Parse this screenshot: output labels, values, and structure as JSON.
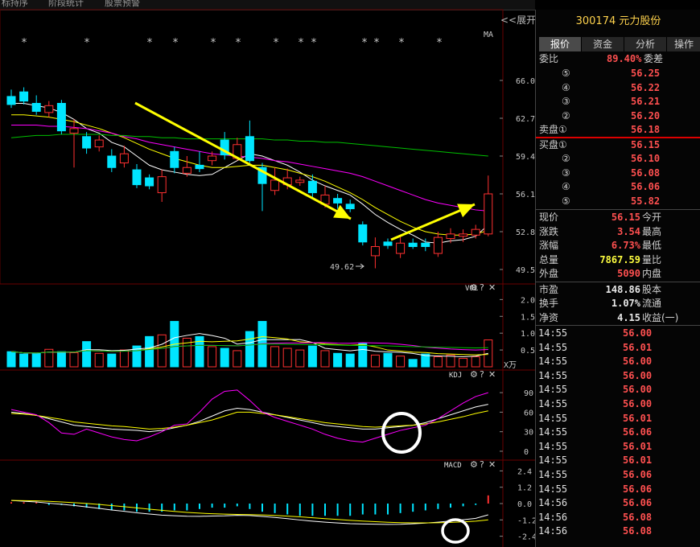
{
  "top_tabs": [
    "标持序",
    "阶段统计",
    "股票预警"
  ],
  "expand_label": "<<展开",
  "stock_title": "300174 元力股份",
  "side_tabs": [
    "报价",
    "资金",
    "分析",
    "操作"
  ],
  "order_book": {
    "wei_bi_label": "委比",
    "wei_bi_value": "89.40%",
    "wei_cha_label": "委差",
    "asks": [
      {
        "label": "⑤",
        "price": "56.25"
      },
      {
        "label": "④",
        "price": "56.22"
      },
      {
        "label": "③",
        "price": "56.21"
      },
      {
        "label": "②",
        "price": "56.20"
      },
      {
        "label": "卖盘①",
        "price": "56.18"
      }
    ],
    "bids": [
      {
        "label": "买盘①",
        "price": "56.15"
      },
      {
        "label": "②",
        "price": "56.10"
      },
      {
        "label": "③",
        "price": "56.08"
      },
      {
        "label": "④",
        "price": "56.06"
      },
      {
        "label": "⑤",
        "price": "55.82"
      }
    ]
  },
  "quote": [
    {
      "label": "现价",
      "value": "56.15",
      "label2": "今开"
    },
    {
      "label": "涨跌",
      "value": "3.54",
      "label2": "最高"
    },
    {
      "label": "涨幅",
      "value": "6.73%",
      "label2": "最低"
    },
    {
      "label": "总量",
      "value": "7867.59",
      "label2": "量比"
    },
    {
      "label": "外盘",
      "value": "5090",
      "label2": "内盘"
    }
  ],
  "fundamentals": [
    {
      "label": "市盈",
      "value": "148.86",
      "label2": "股本"
    },
    {
      "label": "换手",
      "value": "1.07%",
      "label2": "流通"
    },
    {
      "label": "净资",
      "value": "4.15",
      "label2": "收益(一)"
    }
  ],
  "trades": [
    {
      "time": "14:55",
      "price": "56.00"
    },
    {
      "time": "14:55",
      "price": "56.01"
    },
    {
      "time": "14:55",
      "price": "56.00"
    },
    {
      "time": "14:55",
      "price": "56.00"
    },
    {
      "time": "14:55",
      "price": "56.00"
    },
    {
      "time": "14:55",
      "price": "56.00"
    },
    {
      "time": "14:55",
      "price": "56.01"
    },
    {
      "time": "14:55",
      "price": "56.06"
    },
    {
      "time": "14:55",
      "price": "56.01"
    },
    {
      "time": "14:55",
      "price": "56.01"
    },
    {
      "time": "14:55",
      "price": "56.06"
    },
    {
      "time": "14:55",
      "price": "56.06"
    },
    {
      "time": "14:56",
      "price": "56.06"
    },
    {
      "time": "14:56",
      "price": "56.08"
    },
    {
      "time": "14:56",
      "price": "56.08"
    }
  ],
  "chart_labels": {
    "ma": "MA",
    "vol": "VOL",
    "kdj": "KDJ",
    "macd": "MACD",
    "vol_unit": "X万",
    "low_marker": "49.62",
    "price_ticks": [
      "66.0",
      "62.7",
      "59.4",
      "56.1",
      "52.8",
      "49.5"
    ],
    "vol_ticks": [
      "2.0",
      "1.5",
      "1.0",
      "0.5"
    ],
    "kdj_ticks": [
      "90",
      "60",
      "30",
      "0"
    ],
    "macd_ticks": [
      "2.4",
      "1.2",
      "0.0",
      "-1.2",
      "-2.4"
    ]
  },
  "colors": {
    "up": "#ff3030",
    "down": "#00e5ff",
    "ma5": "#ffffff",
    "ma10": "#ffff00",
    "ma20": "#ff00ff",
    "ma60": "#00c000",
    "arrow": "#ffff00",
    "bg": "#000000"
  },
  "chart_data": [
    {
      "type": "candlestick",
      "title": "",
      "ylim": [
        49.5,
        66.0
      ],
      "candles": [
        {
          "o": 64.6,
          "c": 63.9,
          "h": 65.2,
          "l": 63.6
        },
        {
          "o": 65.0,
          "c": 64.2,
          "h": 65.4,
          "l": 63.9
        },
        {
          "o": 64.0,
          "c": 63.3,
          "h": 64.7,
          "l": 63.0
        },
        {
          "o": 63.2,
          "c": 63.8,
          "h": 64.2,
          "l": 62.8
        },
        {
          "o": 64.0,
          "c": 61.6,
          "h": 64.3,
          "l": 61.3
        },
        {
          "o": 61.4,
          "c": 61.8,
          "h": 62.6,
          "l": 58.4
        },
        {
          "o": 61.1,
          "c": 60.1,
          "h": 61.5,
          "l": 59.6
        },
        {
          "o": 60.2,
          "c": 60.8,
          "h": 61.2,
          "l": 59.8
        },
        {
          "o": 59.4,
          "c": 58.4,
          "h": 60.0,
          "l": 58.0
        },
        {
          "o": 58.8,
          "c": 59.6,
          "h": 60.3,
          "l": 58.4
        },
        {
          "o": 58.2,
          "c": 56.9,
          "h": 58.7,
          "l": 56.6
        },
        {
          "o": 57.5,
          "c": 56.8,
          "h": 57.8,
          "l": 56.5
        },
        {
          "o": 56.2,
          "c": 57.6,
          "h": 58.2,
          "l": 55.4
        },
        {
          "o": 59.8,
          "c": 58.4,
          "h": 60.2,
          "l": 57.9
        },
        {
          "o": 57.9,
          "c": 58.4,
          "h": 59.4,
          "l": 57.6
        },
        {
          "o": 58.6,
          "c": 58.3,
          "h": 59.8,
          "l": 58.0
        },
        {
          "o": 59.0,
          "c": 59.4,
          "h": 59.8,
          "l": 58.6
        },
        {
          "o": 60.8,
          "c": 59.5,
          "h": 61.5,
          "l": 59.1
        },
        {
          "o": 59.2,
          "c": 60.4,
          "h": 61.0,
          "l": 59.0
        },
        {
          "o": 61.1,
          "c": 59.0,
          "h": 62.5,
          "l": 58.8
        },
        {
          "o": 58.4,
          "c": 57.0,
          "h": 58.8,
          "l": 54.6
        },
        {
          "o": 56.4,
          "c": 57.3,
          "h": 58.4,
          "l": 56.0
        },
        {
          "o": 56.9,
          "c": 57.5,
          "h": 58.3,
          "l": 56.5
        },
        {
          "o": 57.1,
          "c": 57.3,
          "h": 57.6,
          "l": 56.8
        },
        {
          "o": 57.2,
          "c": 56.2,
          "h": 57.8,
          "l": 55.8
        },
        {
          "o": 55.2,
          "c": 56.0,
          "h": 56.8,
          "l": 54.9
        },
        {
          "o": 55.7,
          "c": 55.3,
          "h": 56.1,
          "l": 54.8
        },
        {
          "o": 55.2,
          "c": 54.8,
          "h": 55.6,
          "l": 54.5
        },
        {
          "o": 53.4,
          "c": 51.9,
          "h": 53.7,
          "l": 51.6
        },
        {
          "o": 50.7,
          "c": 51.5,
          "h": 52.3,
          "l": 49.6
        },
        {
          "o": 51.9,
          "c": 51.6,
          "h": 52.2,
          "l": 51.3
        },
        {
          "o": 50.9,
          "c": 51.8,
          "h": 52.4,
          "l": 50.5
        },
        {
          "o": 51.8,
          "c": 51.5,
          "h": 52.2,
          "l": 51.3
        },
        {
          "o": 51.8,
          "c": 51.5,
          "h": 52.2,
          "l": 51.1
        },
        {
          "o": 50.9,
          "c": 52.3,
          "h": 52.8,
          "l": 50.6
        },
        {
          "o": 52.2,
          "c": 52.6,
          "h": 53.1,
          "l": 51.8
        },
        {
          "o": 52.4,
          "c": 52.6,
          "h": 53.0,
          "l": 51.9
        },
        {
          "o": 52.5,
          "c": 53.0,
          "h": 53.4,
          "l": 52.2
        },
        {
          "o": 52.6,
          "c": 56.1,
          "h": 57.7,
          "l": 52.4
        }
      ],
      "ma": {
        "ma5": [
          64.0,
          64.0,
          63.8,
          63.6,
          63.2,
          62.6,
          61.8,
          61.4,
          60.6,
          60.2,
          59.4,
          58.6,
          58.2,
          58.0,
          57.8,
          57.7,
          57.8,
          58.4,
          59.0,
          59.6,
          59.4,
          59.0,
          58.6,
          58.0,
          57.3,
          56.8,
          56.4,
          56.0,
          55.2,
          54.3,
          53.6,
          53.0,
          52.5,
          51.9,
          51.8,
          52.0,
          52.1,
          52.4,
          53.4
        ],
        "ma10": [
          63.0,
          63.0,
          62.9,
          62.8,
          62.6,
          62.4,
          62.1,
          61.8,
          61.4,
          61.0,
          60.5,
          60.0,
          59.6,
          59.2,
          58.9,
          58.6,
          58.4,
          58.4,
          58.5,
          58.6,
          58.6,
          58.4,
          58.2,
          57.9,
          57.6,
          57.2,
          56.7,
          56.2,
          55.6,
          54.9,
          54.3,
          53.7,
          53.2,
          52.8,
          52.6,
          52.5,
          52.5,
          52.6,
          52.9
        ],
        "ma20": [
          62.1,
          62.1,
          62.1,
          62.0,
          62.0,
          61.9,
          61.8,
          61.6,
          61.4,
          61.1,
          60.9,
          60.6,
          60.4,
          60.2,
          60.0,
          59.8,
          59.6,
          59.5,
          59.4,
          59.3,
          59.2,
          59.0,
          58.9,
          58.7,
          58.5,
          58.3,
          58.1,
          57.9,
          57.6,
          57.2,
          56.8,
          56.4,
          56.0,
          55.6,
          55.3,
          55.1,
          54.9,
          54.7,
          54.6
        ],
        "ma60": [
          61.0,
          61.1,
          61.2,
          61.2,
          61.3,
          61.3,
          61.3,
          61.3,
          61.2,
          61.2,
          61.1,
          61.1,
          61.0,
          61.0,
          60.9,
          60.9,
          60.9,
          60.9,
          60.9,
          60.9,
          60.9,
          60.8,
          60.8,
          60.7,
          60.7,
          60.6,
          60.6,
          60.5,
          60.4,
          60.3,
          60.2,
          60.1,
          60.0,
          59.9,
          59.8,
          59.7,
          59.6,
          59.5,
          59.4
        ]
      }
    },
    {
      "type": "bar",
      "title": "VOL",
      "ylim": [
        0,
        2.2
      ],
      "values": [
        0.45,
        0.38,
        0.4,
        0.52,
        0.45,
        0.42,
        0.75,
        0.4,
        0.38,
        0.5,
        0.62,
        0.9,
        0.95,
        1.35,
        0.85,
        0.9,
        0.6,
        0.55,
        0.48,
        1.05,
        1.35,
        0.6,
        0.55,
        0.5,
        0.62,
        0.48,
        0.4,
        0.38,
        0.7,
        0.35,
        0.4,
        0.32,
        0.22,
        0.38,
        0.3,
        0.35,
        0.25,
        0.3,
        0.8
      ]
    },
    {
      "type": "line",
      "title": "KDJ",
      "ylim": [
        -5,
        100
      ],
      "series": [
        {
          "values": [
            60,
            58,
            55,
            50,
            45,
            40,
            38,
            36,
            34,
            33,
            32,
            30,
            32,
            36,
            40,
            46,
            54,
            62,
            66,
            64,
            60,
            56,
            52,
            48,
            44,
            40,
            38,
            36,
            34,
            34,
            36,
            38,
            40,
            44,
            50,
            56,
            62,
            68,
            72
          ]
        },
        {
          "values": [
            58,
            57,
            55,
            52,
            49,
            45,
            43,
            41,
            39,
            38,
            36,
            34,
            35,
            37,
            40,
            44,
            48,
            54,
            60,
            60,
            58,
            56,
            53,
            50,
            47,
            44,
            42,
            40,
            38,
            37,
            38,
            39,
            40,
            42,
            45,
            49,
            53,
            58,
            62
          ]
        },
        {
          "values": [
            64,
            60,
            56,
            44,
            28,
            26,
            34,
            28,
            22,
            18,
            16,
            22,
            30,
            40,
            42,
            60,
            80,
            92,
            94,
            78,
            60,
            52,
            46,
            40,
            34,
            26,
            20,
            16,
            14,
            20,
            26,
            32,
            36,
            40,
            50,
            62,
            74,
            84,
            90
          ]
        }
      ]
    },
    {
      "type": "bar",
      "title": "MACD",
      "ylim": [
        -2.6,
        2.6
      ],
      "values": [
        0.1,
        0.1,
        0.1,
        -0.1,
        -0.1,
        -0.2,
        -0.3,
        -0.4,
        -0.5,
        -0.5,
        -0.6,
        -0.6,
        -0.6,
        -0.5,
        -0.5,
        -0.4,
        -0.3,
        -0.3,
        -0.2,
        -0.4,
        -0.6,
        -0.7,
        -0.8,
        -0.9,
        -0.9,
        -0.9,
        -0.9,
        -0.9,
        -0.8,
        -0.8,
        -0.8,
        -0.7,
        -0.6,
        -0.5,
        -0.4,
        -0.3,
        -0.2,
        -0.1,
        0.6
      ]
    }
  ]
}
